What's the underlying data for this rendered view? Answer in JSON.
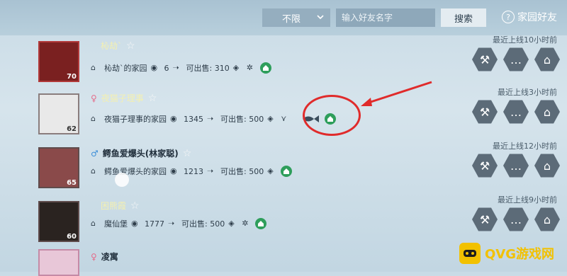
{
  "header": {
    "filter_label": "不限",
    "search_placeholder": "输入好友名字",
    "search_button": "搜索",
    "title": "家园好友"
  },
  "friends": [
    {
      "name": "杺劫`",
      "gender": "",
      "home": "杺劫`的家园",
      "visits": "6",
      "sellable": "可出售: 310",
      "last_online": "最近上线10小时前",
      "level": "70"
    },
    {
      "name": "夜猫子理事",
      "gender": "female",
      "home": "夜猫子理事的家园",
      "visits": "1345",
      "sellable": "可出售: 500",
      "last_online": "最近上线3小时前",
      "level": "62"
    },
    {
      "name": "鳄鱼爱爆头(林家聪)",
      "gender": "male",
      "home": "鳄鱼爱爆头的家园",
      "visits": "1213",
      "sellable": "可出售: 500",
      "last_online": "最近上线12小时前",
      "level": "65"
    },
    {
      "name": "困熊霞",
      "gender": "",
      "home": "魔仙堡",
      "visits": "1777",
      "sellable": "可出售: 500",
      "last_online": "最近上线9小时前",
      "level": "60"
    },
    {
      "name": "凌寓",
      "gender": "female",
      "home": "",
      "visits": "",
      "sellable": "",
      "last_online": "",
      "level": ""
    }
  ],
  "watermark": {
    "text": "QVG游戏网"
  },
  "colors": {
    "accent_red": "#e02b2b",
    "home_green": "#2e9e5b",
    "name_yellow": "#f4f0b0"
  },
  "icons": [
    "house-icon",
    "eye-icon",
    "fish-icon",
    "badge-icon",
    "star-icon",
    "hammer-icon",
    "chat-icon",
    "home-up-icon"
  ]
}
